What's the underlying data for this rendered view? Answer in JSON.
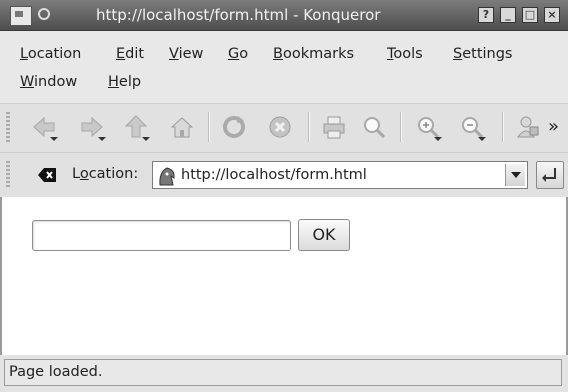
{
  "window": {
    "title": "http://localhost/form.html - Konqueror"
  },
  "menubar": {
    "row1": [
      {
        "label": "Location",
        "mnemonic_index": 0
      },
      {
        "label": "Edit",
        "mnemonic_index": 0
      },
      {
        "label": "View",
        "mnemonic_index": 0
      },
      {
        "label": "Go",
        "mnemonic_index": 0
      },
      {
        "label": "Bookmarks",
        "mnemonic_index": 0
      },
      {
        "label": "Tools",
        "mnemonic_index": 0
      },
      {
        "label": "Settings",
        "mnemonic_index": 0
      }
    ],
    "row2": [
      {
        "label": "Window",
        "mnemonic_index": 0
      },
      {
        "label": "Help",
        "mnemonic_index": 0
      }
    ]
  },
  "toolbar": {
    "buttons": [
      "back-icon",
      "forward-icon",
      "up-icon",
      "home-icon",
      "reload-icon",
      "stop-icon",
      "print-icon",
      "find-icon",
      "zoom-in-icon",
      "zoom-out-icon",
      "security-icon"
    ],
    "overflow_label": "»"
  },
  "location_bar": {
    "label": "Location:",
    "mnemonic_index": 1,
    "url": "http://localhost/form.html"
  },
  "page": {
    "text_field_value": "",
    "ok_button_label": "OK"
  },
  "status": {
    "text": "Page loaded."
  },
  "colors": {
    "titlebar": "#5e5e5e",
    "chrome": "#e3e3e3",
    "content": "#ffffff"
  }
}
